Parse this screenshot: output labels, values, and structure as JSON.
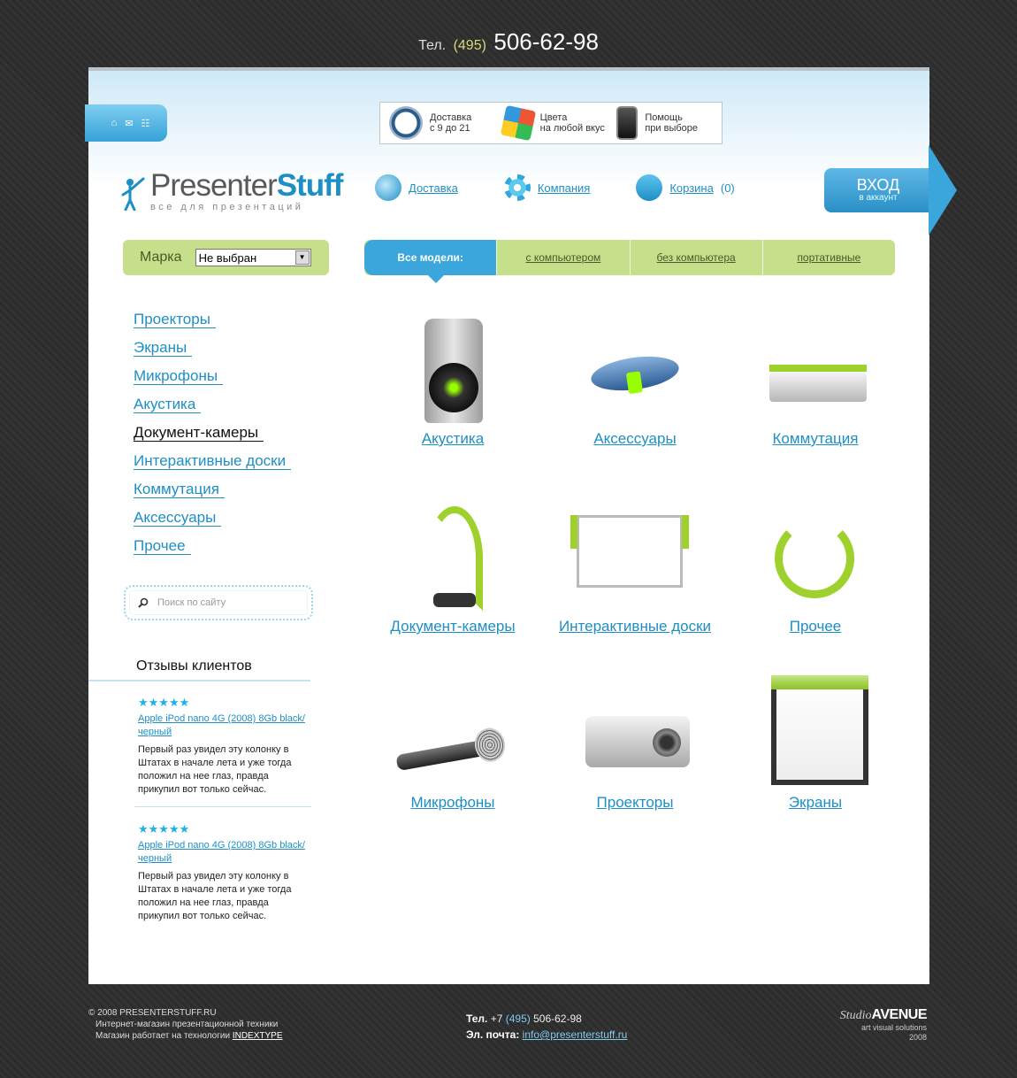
{
  "top_phone": {
    "label": "Тел.",
    "code": "(495)",
    "number": "506-62-98"
  },
  "mini_icons": [
    "home-icon",
    "mail-icon",
    "sitemap-icon"
  ],
  "promo": [
    {
      "icon": "clock-icon",
      "line1": "Доставка",
      "line2": "с 9 до 21"
    },
    {
      "icon": "rubiks-cube-icon",
      "line1": "Цвета",
      "line2": "на любой вкус"
    },
    {
      "icon": "phone-icon",
      "line1": "Помощь",
      "line2": "при выборе"
    }
  ],
  "logo": {
    "part1": "Presenter",
    "part2": "Stuff",
    "tagline": "все для презентаций"
  },
  "topnav": [
    {
      "icon": "globe-icon",
      "label": "Доставка"
    },
    {
      "icon": "flower-icon",
      "label": "Компания"
    },
    {
      "icon": "cart-icon",
      "label": "Корзина",
      "count": "(0)"
    }
  ],
  "login": {
    "title": "ВХОД",
    "subtitle": "в аккаунт"
  },
  "brand": {
    "label": "Марка",
    "selected": "Не выбран"
  },
  "tabs": [
    "Все модели:",
    "с компьютером",
    "без компьютера",
    "портативные"
  ],
  "categories": [
    "Проекторы",
    "Экраны",
    "Микрофоны",
    "Акустика",
    "Документ-камеры",
    "Интерактивные доски",
    "Коммутация",
    "Аксессуары",
    "Прочее"
  ],
  "active_category": "Документ-камеры",
  "search": {
    "placeholder": "Поиск по сайту"
  },
  "reviews": {
    "title": "Отзывы клиентов",
    "items": [
      {
        "stars": "★★★★★",
        "product": "Apple iPod nano 4G (2008) 8Gb black/черный",
        "text": "Первый раз увидел эту колонку в Штатах в начале лета и уже тогда положил на нее глаз, правда прикупил вот только сейчас."
      },
      {
        "stars": "★★★★★",
        "product": "Apple iPod nano 4G (2008) 8Gb black/черный",
        "text": "Первый раз увидел эту колонку в Штатах в начале лета и уже тогда положил на нее глаз, правда прикупил вот только сейчас."
      }
    ]
  },
  "products": [
    {
      "name": "Акустика",
      "icon": "speaker-icon"
    },
    {
      "name": "Аксессуары",
      "icon": "remote-icon"
    },
    {
      "name": "Коммутация",
      "icon": "switch-box-icon"
    },
    {
      "name": "Документ-камеры",
      "icon": "document-camera-icon"
    },
    {
      "name": "Интерактивные доски",
      "icon": "whiteboard-icon"
    },
    {
      "name": "Прочее",
      "icon": "cable-icon"
    },
    {
      "name": "Микрофоны",
      "icon": "microphone-icon"
    },
    {
      "name": "Проекторы",
      "icon": "projector-icon"
    },
    {
      "name": "Экраны",
      "icon": "screen-icon"
    }
  ],
  "footer": {
    "copyright": "© 2008 PRESENTERSTUFF.RU",
    "desc": "Интернет-магазин презентационной техники",
    "tech_prefix": "Магазин работает на технологии",
    "tech_link": "INDEXTYPE",
    "phone_label": "Тел.",
    "phone_prefix": "+7",
    "phone_code": "(495)",
    "phone_number": "506-62-98",
    "email_label": "Эл. почта:",
    "email": "info@presenterstuff.ru",
    "studio_script": "Studio",
    "studio_name": "AVENUE",
    "studio_sub": "art visual solutions",
    "studio_year": "2008"
  }
}
